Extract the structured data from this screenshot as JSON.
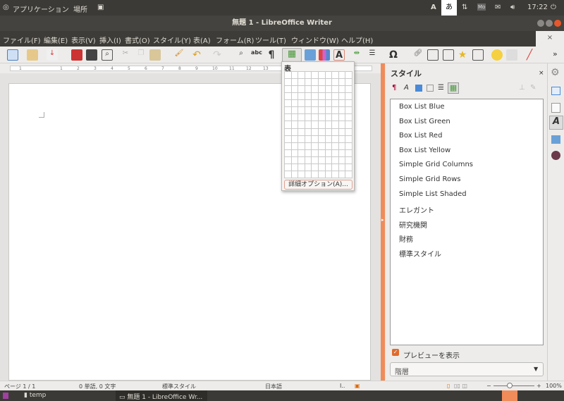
{
  "top_panel": {
    "applications": "アプリケーション",
    "places": "場所",
    "input_a": "A",
    "input_hiragana": "あ",
    "clock": "17:22",
    "indicator_mo": "Mo"
  },
  "window": {
    "title": "無題 1 - LibreOffice Writer",
    "tab_close": "×"
  },
  "menu": [
    "ファイル(F)",
    "編集(E)",
    "表示(V)",
    "挿入(I)",
    "書式(O)",
    "スタイル(Y)",
    "表(A)",
    "フォーム(R)",
    "ツール(T)",
    "ウィンドウ(W)",
    "ヘルプ(H)"
  ],
  "toolbar": {
    "overflow": "»"
  },
  "ruler": {
    "ticks": [
      "1",
      "1",
      "2",
      "3",
      "4",
      "5",
      "6",
      "7",
      "8",
      "9",
      "10",
      "11",
      "12",
      "13"
    ]
  },
  "table_popup": {
    "title": "表",
    "columns": 10,
    "rows": 15,
    "more_options": "詳細オプション(A)..."
  },
  "sidebar": {
    "title": "スタイル",
    "close": "×",
    "styles": [
      "Box List Blue",
      "Box List Green",
      "Box List Red",
      "Box List Yellow",
      "Simple Grid Columns",
      "Simple Grid Rows",
      "Simple List Shaded",
      "エレガント",
      "研究機関",
      "財務",
      "標準スタイル"
    ],
    "preview_label": "プレビューを表示",
    "preview_checked": true,
    "filter": "階層"
  },
  "status": {
    "page": "ページ 1 / 1",
    "words": "0 単語, 0 文字",
    "style": "標準スタイル",
    "language": "日本語",
    "zoom": "100%",
    "zoom_minus": "−",
    "zoom_plus": "+"
  },
  "taskbar": {
    "items": [
      "temp",
      "無題 1 - LibreOffice Wr..."
    ]
  },
  "colors": {
    "accent": "#f08c5a",
    "panel": "#3b3a36"
  }
}
